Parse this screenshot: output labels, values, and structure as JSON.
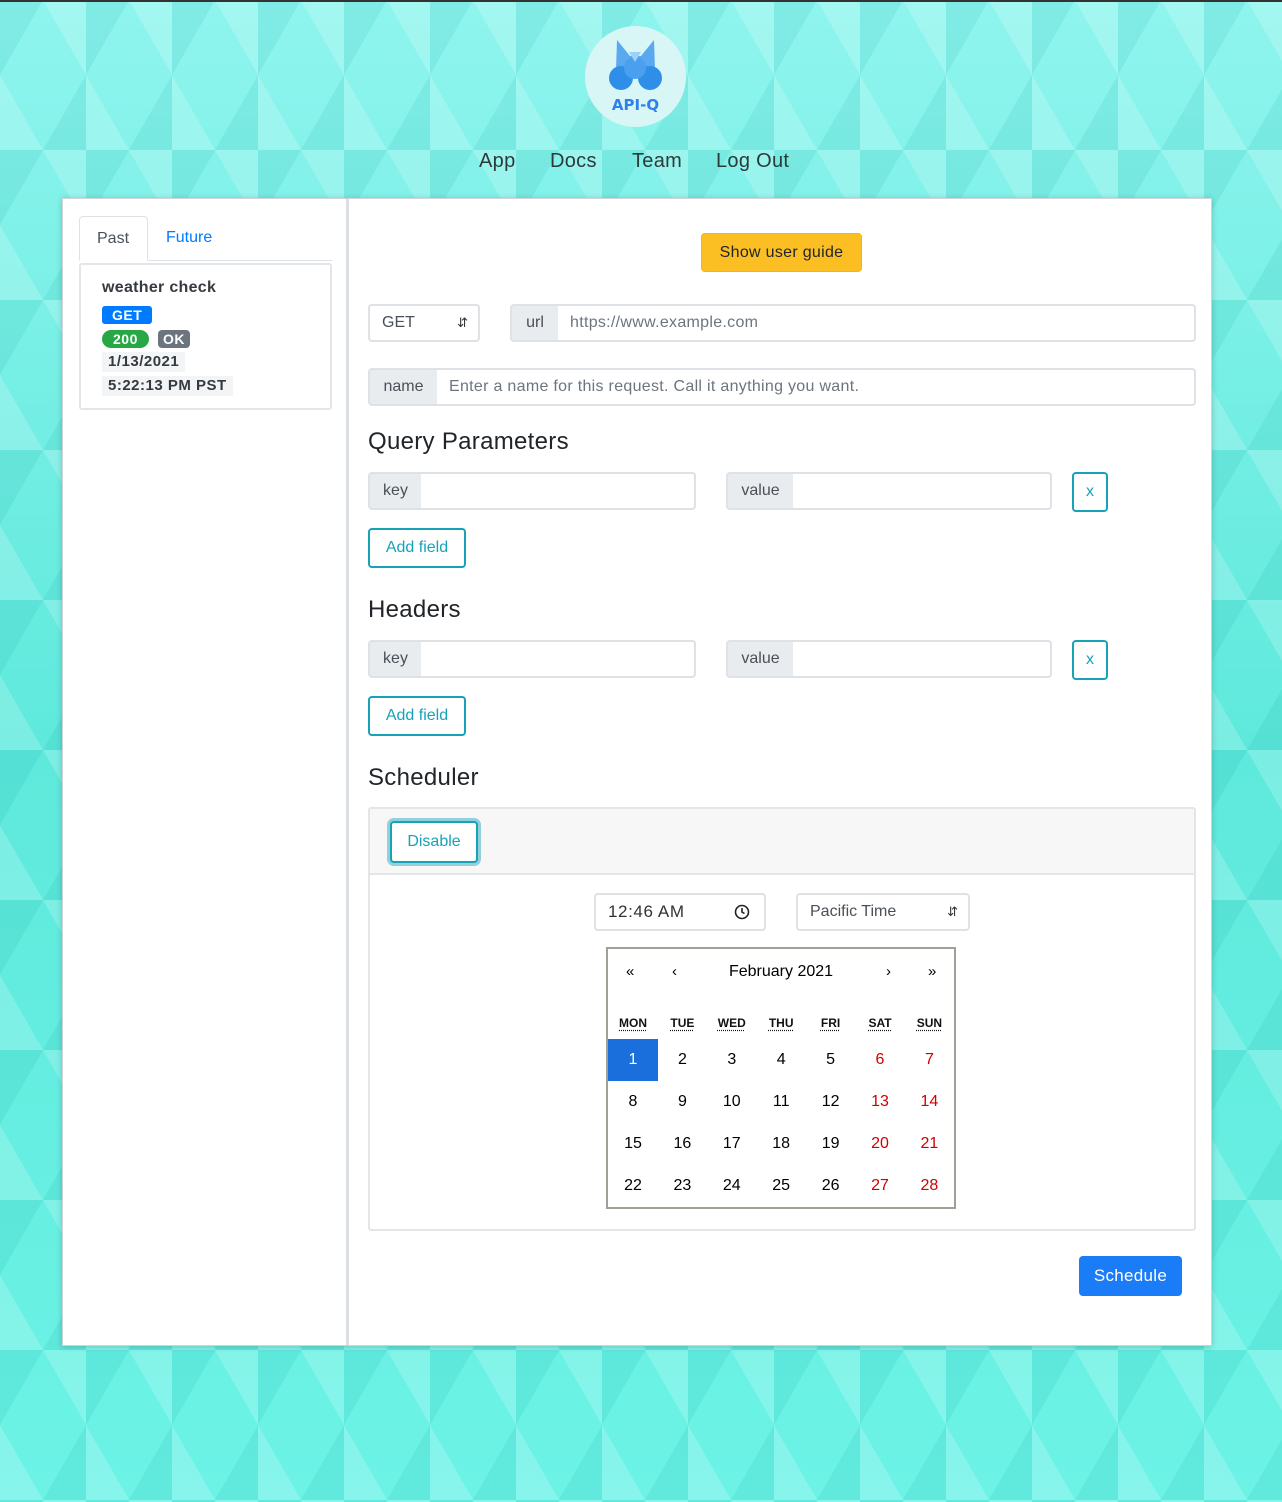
{
  "app": {
    "logo_text": "API-Q"
  },
  "nav": {
    "items": [
      "App",
      "Docs",
      "Team",
      "Log Out"
    ]
  },
  "sidebar": {
    "tabs": [
      "Past",
      "Future"
    ],
    "history": {
      "name": "weather check",
      "method": "GET",
      "status_code": "200",
      "status_text": "OK",
      "date": "1/13/2021",
      "time": "5:22:13 PM PST"
    }
  },
  "main": {
    "guide_label": "Show user guide",
    "method_select": "GET",
    "url": {
      "addon": "url",
      "placeholder": "https://www.example.com"
    },
    "name": {
      "addon": "name",
      "placeholder": "Enter a name for this request. Call it anything you want."
    },
    "query": {
      "heading": "Query Parameters",
      "key_label": "key",
      "value_label": "value",
      "remove_label": "x",
      "add_label": "Add field"
    },
    "headers": {
      "heading": "Headers",
      "key_label": "key",
      "value_label": "value",
      "remove_label": "x",
      "add_label": "Add field"
    },
    "scheduler": {
      "heading": "Scheduler",
      "disable_label": "Disable",
      "time": "12:46 AM",
      "timezone": "Pacific Time",
      "calendar": {
        "nav_prev_year": "«",
        "nav_prev": "‹",
        "nav_next": "›",
        "nav_next_year": "»",
        "title": "February 2021",
        "weekdays": [
          "MON",
          "TUE",
          "WED",
          "THU",
          "FRI",
          "SAT",
          "SUN"
        ],
        "weeks": [
          [
            "1",
            "2",
            "3",
            "4",
            "5",
            "6",
            "7"
          ],
          [
            "8",
            "9",
            "10",
            "11",
            "12",
            "13",
            "14"
          ],
          [
            "15",
            "16",
            "17",
            "18",
            "19",
            "20",
            "21"
          ],
          [
            "22",
            "23",
            "24",
            "25",
            "26",
            "27",
            "28"
          ]
        ],
        "selected_day": "1"
      }
    },
    "schedule_label": "Schedule"
  },
  "colors": {
    "accent": "#007bff",
    "outline": "#17a2b8",
    "guide": "#fbbf24",
    "weekend": "#d10000",
    "selected": "#1a6fdc"
  }
}
